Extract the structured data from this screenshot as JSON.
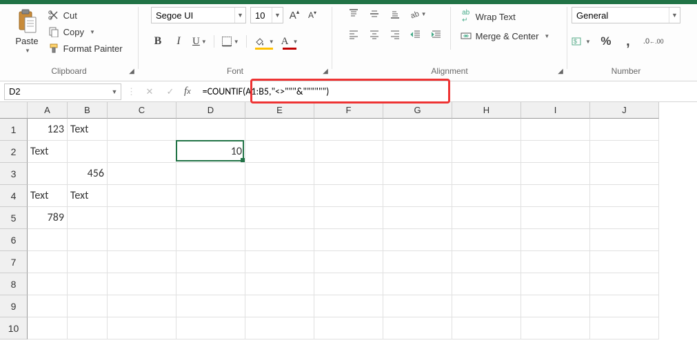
{
  "clipboard": {
    "paste_label": "Paste",
    "cut_label": "Cut",
    "copy_label": "Copy",
    "format_painter_label": "Format Painter",
    "group_label": "Clipboard"
  },
  "font": {
    "name": "Segoe UI",
    "size": "10",
    "group_label": "Font"
  },
  "alignment": {
    "wrap_label": "Wrap Text",
    "merge_label": "Merge & Center",
    "group_label": "Alignment"
  },
  "number": {
    "format": "General",
    "group_label": "Number"
  },
  "formula_bar": {
    "cell_ref": "D2",
    "formula": "=COUNTIF(A1:B5,\"<>\"\"\"&\"\"\"\"\"\")"
  },
  "grid": {
    "columns": [
      "A",
      "B",
      "C",
      "D",
      "E",
      "F",
      "G",
      "H",
      "I",
      "J"
    ],
    "col_widths": {
      "A": 58,
      "B": 58,
      "C": 100,
      "D": 100,
      "E": 100,
      "F": 100,
      "G": 100,
      "H": 100,
      "I": 100,
      "J": 100
    },
    "rows": [
      "1",
      "2",
      "3",
      "4",
      "5",
      "6",
      "7",
      "8",
      "9",
      "10"
    ],
    "cells": {
      "A1": {
        "v": "123",
        "n": true
      },
      "B1": {
        "v": "Text"
      },
      "A2": {
        "v": "Text"
      },
      "D2": {
        "v": "10",
        "n": true
      },
      "B3": {
        "v": "456",
        "n": true
      },
      "A4": {
        "v": "Text"
      },
      "B4": {
        "v": "Text"
      },
      "A5": {
        "v": "789",
        "n": true
      }
    },
    "selected": "D2"
  },
  "colors": {
    "brand": "#217346",
    "fill_accent": "#ffc000",
    "font_accent": "#c00000"
  }
}
